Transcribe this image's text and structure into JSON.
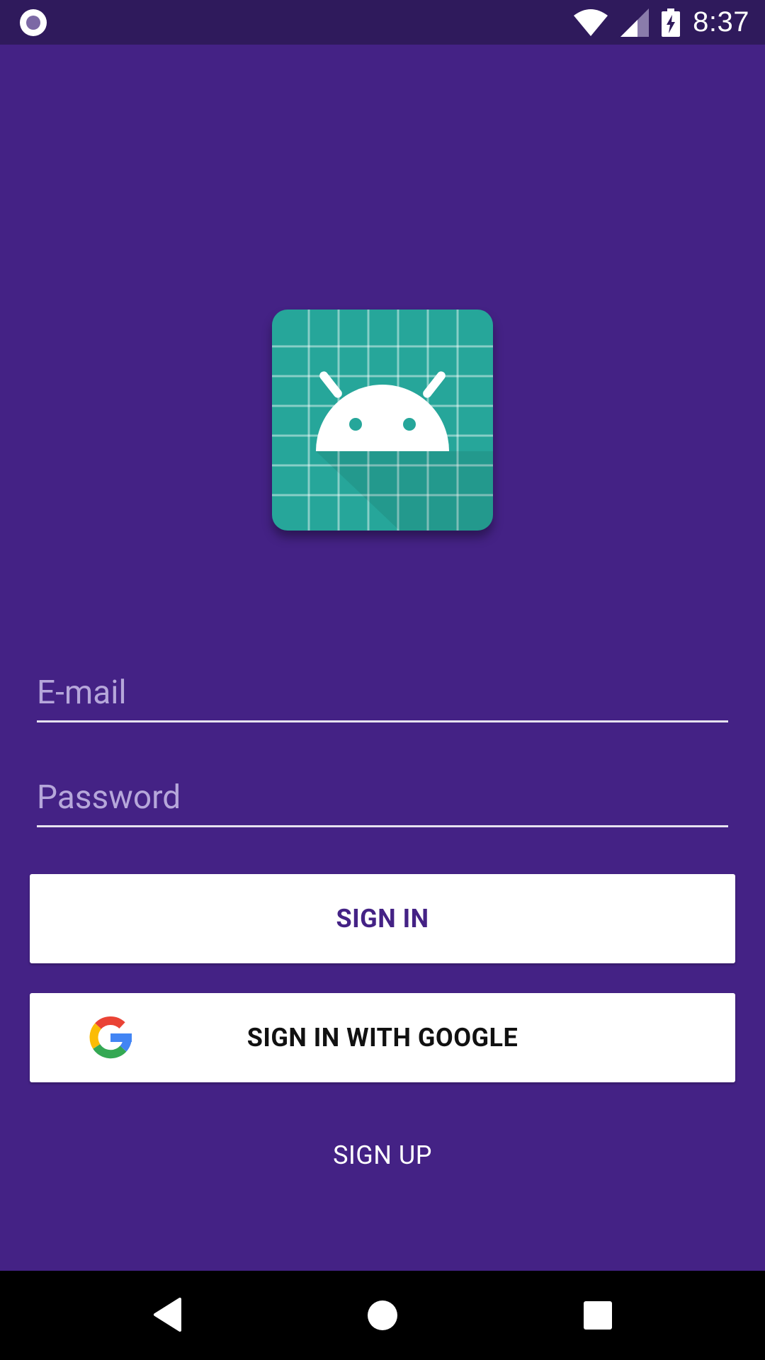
{
  "status_bar": {
    "time": "8:37",
    "icons": [
      "notification-dot-icon",
      "wifi-icon",
      "cell-signal-icon",
      "battery-charging-icon"
    ]
  },
  "colors": {
    "background": "#442285",
    "status_bar": "#2f1a5c",
    "app_icon": "#26a69a",
    "button": "#ffffff",
    "sign_in_text": "#442285",
    "placeholder": "#b6a7da"
  },
  "form": {
    "email_placeholder": "E-mail",
    "password_placeholder": "Password"
  },
  "buttons": {
    "sign_in": "SIGN IN",
    "sign_in_google": "SIGN IN WITH GOOGLE",
    "sign_up": "SIGN UP"
  },
  "nav_bar": {
    "icons": [
      "back-icon",
      "home-icon",
      "recents-icon"
    ]
  }
}
